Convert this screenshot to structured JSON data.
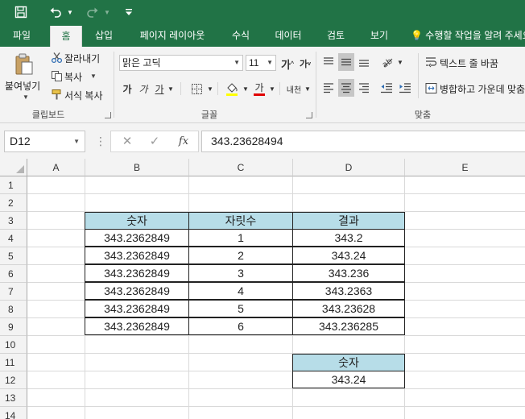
{
  "quick_access": {
    "save_icon": "save-icon",
    "undo_icon": "undo-icon",
    "redo_icon": "redo-icon",
    "customize_icon": "customize-qat-icon"
  },
  "tabs": [
    {
      "label": "파일"
    },
    {
      "label": "홈"
    },
    {
      "label": "삽입"
    },
    {
      "label": "페이지 레이아웃"
    },
    {
      "label": "수식"
    },
    {
      "label": "데이터"
    },
    {
      "label": "검토"
    },
    {
      "label": "보기"
    }
  ],
  "tell_me": "수행할 작업을 알려 주세요",
  "ribbon": {
    "clipboard": {
      "paste": "붙여넣기",
      "cut": "잘라내기",
      "copy": "복사",
      "format_painter": "서식 복사",
      "group": "클립보드"
    },
    "font": {
      "font_name": "맑은 고딕",
      "font_size": "11",
      "bold": "가",
      "italic": "가",
      "underline": "가",
      "phonetic": "내천",
      "group": "글꼴"
    },
    "alignment": {
      "wrap_text": "텍스트 줄 바꿈",
      "merge_center": "병합하고 가운데 맞춤",
      "group": "맞춤"
    }
  },
  "formula_bar": {
    "name_box": "D12",
    "cancel": "✕",
    "enter": "✓",
    "fx": "fx",
    "value": "343.23628494"
  },
  "columns": [
    "A",
    "B",
    "C",
    "D",
    "E"
  ],
  "rows": [
    "1",
    "2",
    "3",
    "4",
    "5",
    "6",
    "7",
    "8",
    "9",
    "10",
    "11",
    "12",
    "13",
    "14"
  ],
  "table": {
    "headers": [
      "숫자",
      "자릿수",
      "결과"
    ],
    "rows": [
      [
        "343.2362849",
        "1",
        "343.2"
      ],
      [
        "343.2362849",
        "2",
        "343.24"
      ],
      [
        "343.2362849",
        "3",
        "343.236"
      ],
      [
        "343.2362849",
        "4",
        "343.2363"
      ],
      [
        "343.2362849",
        "5",
        "343.23628"
      ],
      [
        "343.2362849",
        "6",
        "343.236285"
      ]
    ]
  },
  "small_table": {
    "header": "숫자",
    "value": "343.24"
  },
  "colors": {
    "brand": "#217346",
    "header_fill": "#b7dde8"
  }
}
